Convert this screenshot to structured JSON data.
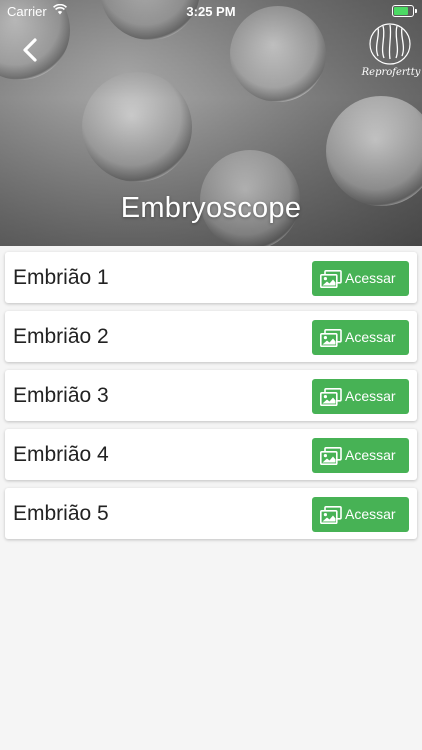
{
  "status_bar": {
    "carrier": "Carrier",
    "time": "3:25 PM",
    "battery_level": 0.9
  },
  "header": {
    "title": "Embryoscope",
    "back_icon": "chevron-left-icon",
    "logo_text": "Reprofertty",
    "background": "embryo-microscopy-image"
  },
  "embryos": [
    {
      "label": "Embrião 1",
      "button_label": "Acessar"
    },
    {
      "label": "Embrião 2",
      "button_label": "Acessar"
    },
    {
      "label": "Embrião 3",
      "button_label": "Acessar"
    },
    {
      "label": "Embrião 4",
      "button_label": "Acessar"
    },
    {
      "label": "Embrião 5",
      "button_label": "Acessar"
    }
  ],
  "colors": {
    "accent_green": "#47b255",
    "page_background": "#f5f5f5"
  }
}
